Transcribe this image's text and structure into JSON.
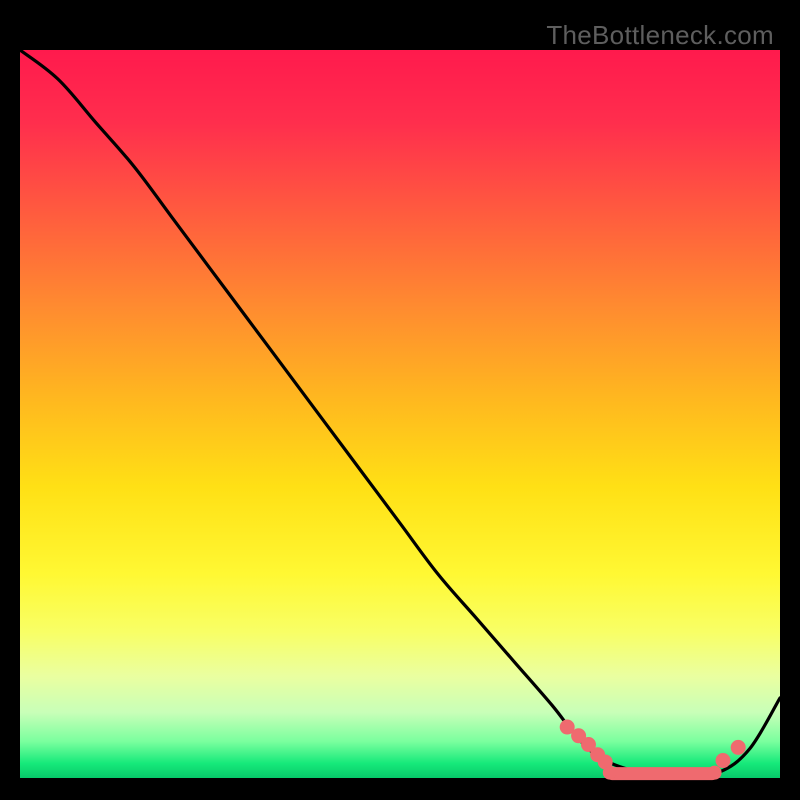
{
  "watermark": "TheBottleneck.com",
  "colors": {
    "page_bg": "#000000",
    "curve": "#000000",
    "markers": "#ef6a6f",
    "gradient_top": "#ff1a4d",
    "gradient_bottom": "#07c96a"
  },
  "chart_data": {
    "type": "line",
    "title": "",
    "xlabel": "",
    "ylabel": "",
    "xlim": [
      0,
      100
    ],
    "ylim": [
      0,
      100
    ],
    "grid": false,
    "legend": false,
    "annotations": [],
    "series": [
      {
        "name": "curve",
        "x": [
          0,
          5,
          10,
          15,
          20,
          25,
          30,
          35,
          40,
          45,
          50,
          55,
          60,
          65,
          70,
          73,
          76,
          80,
          84,
          88,
          92,
          96,
          100
        ],
        "y": [
          100,
          96,
          90,
          84,
          77,
          70,
          63,
          56,
          49,
          42,
          35,
          28,
          22,
          16,
          10,
          6,
          3,
          1.2,
          0.6,
          0.5,
          0.8,
          4,
          11
        ]
      }
    ],
    "markers": {
      "descending_cluster": {
        "x": [
          72,
          73.5,
          74.8,
          76,
          77
        ],
        "y": [
          7.0,
          5.8,
          4.6,
          3.2,
          2.2
        ]
      },
      "floor_band": {
        "x_start": 78,
        "x_end": 91,
        "y": 0.6
      },
      "rising_cluster": {
        "x": [
          92.5,
          94.5
        ],
        "y": [
          2.4,
          4.2
        ]
      }
    }
  }
}
